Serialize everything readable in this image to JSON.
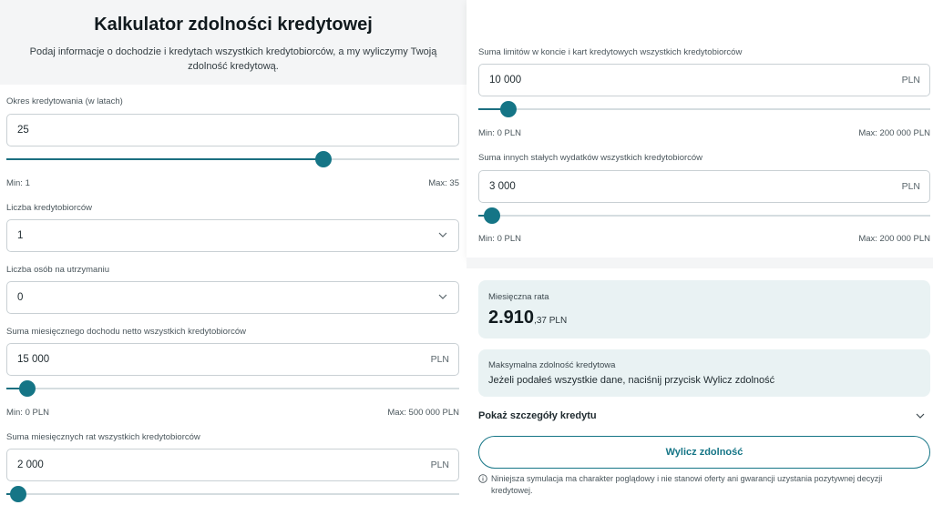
{
  "header": {
    "title": "Kalkulator zdolności kredytowej",
    "subtitle": "Podaj informacje o dochodzie i kredytach wszystkich kredytobiorców, a my wyliczymy Twoją zdolność kredytową."
  },
  "loan_period": {
    "label": "Okres kredytowania (w latach)",
    "value": "25",
    "min_label": "Min: 1",
    "max_label": "Max: 35",
    "slider_fraction": 0.7
  },
  "borrowers": {
    "label": "Liczba kredytobiorców",
    "value": "1"
  },
  "dependents": {
    "label": "Liczba osób na utrzymaniu",
    "value": "0"
  },
  "income": {
    "label": "Suma miesięcznego dochodu netto wszystkich kredytobiorców",
    "value": "15 000",
    "unit": "PLN",
    "min_label": "Min: 0 PLN",
    "max_label": "Max: 500 000 PLN",
    "slider_fraction": 0.046
  },
  "installments": {
    "label": "Suma miesięcznych rat wszystkich kredytobiorców",
    "value": "2 000",
    "unit": "PLN",
    "slider_fraction": 0.027
  },
  "card_limits": {
    "label": "Suma limitów w koncie i kart kredytowych wszystkich kredytobiorców",
    "value": "10 000",
    "unit": "PLN",
    "min_label": "Min: 0 PLN",
    "max_label": "Max: 200 000 PLN",
    "slider_fraction": 0.066
  },
  "other_expenses": {
    "label": "Suma innych stałych wydatków wszystkich kredytobiorców",
    "value": "3 000",
    "unit": "PLN",
    "min_label": "Min: 0 PLN",
    "max_label": "Max: 200 000 PLN",
    "slider_fraction": 0.031
  },
  "result": {
    "monthly_label": "Miesięczna rata",
    "monthly_int": "2.910",
    "monthly_dec": ",37 PLN",
    "max_label": "Maksymalna zdolność kredytowa",
    "max_text": "Jeżeli podałeś wszystkie dane, naciśnij przycisk Wylicz zdolność"
  },
  "details_label": "Pokaż szczegóły kredytu",
  "calculate_button": "Wylicz zdolność",
  "disclaimer": "Niniejsza symulacja ma charakter poglądowy i nie stanowi oferty ani gwarancji uzystania pozytywnej decyzji kredytowej.",
  "colors": {
    "accent": "#157586",
    "card_bg": "#e9f2f3",
    "header_bg": "#f4f5f6"
  }
}
